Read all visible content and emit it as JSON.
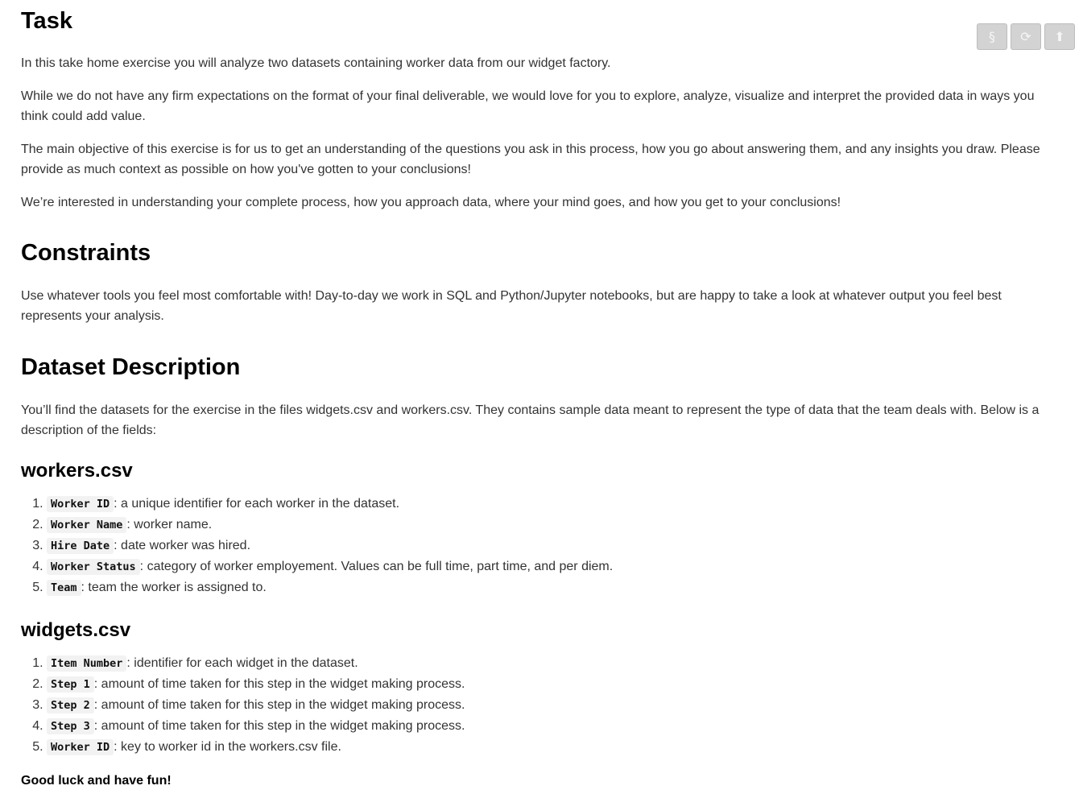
{
  "toolbar": {
    "buttons": [
      {
        "icon": "section-icon",
        "glyph": "§"
      },
      {
        "icon": "refresh-icon",
        "glyph": "⟳"
      },
      {
        "icon": "upload-icon",
        "glyph": "⬆"
      }
    ]
  },
  "task": {
    "heading": "Task",
    "p1": "In this take home exercise you will analyze two datasets containing worker data from our widget factory.",
    "p2": "While we do not have any firm expectations on the format of your final deliverable, we would love for you to explore, analyze, visualize and interpret the provided data in ways you think could add value.",
    "p3": "The main objective of this exercise is for us to get an understanding of the questions you ask in this process, how you go about answering them, and any insights you draw. Please provide as much context as possible on how you've gotten to your conclusions!",
    "p4": "We’re interested in understanding your complete process, how you approach data, where your mind goes, and how you get to your conclusions!"
  },
  "constraints": {
    "heading": "Constraints",
    "p1": "Use whatever tools you feel most comfortable with! Day-to-day we work in SQL and Python/Jupyter notebooks, but are happy to take a look at whatever output you feel best represents your analysis."
  },
  "dataset": {
    "heading": "Dataset Description",
    "p1": "You’ll find the datasets for the exercise in the files widgets.csv and workers.csv. They contains sample data meant to represent the type of data that the team deals with. Below is a description of the fields:"
  },
  "workers": {
    "heading": "workers.csv",
    "items": [
      {
        "field": "Worker ID",
        "desc": ": a unique identifier for each worker in the dataset."
      },
      {
        "field": "Worker Name",
        "desc": ": worker name."
      },
      {
        "field": "Hire Date",
        "desc": ": date worker was hired."
      },
      {
        "field": "Worker Status",
        "desc": ": category of worker employement. Values can be full time, part time, and per diem."
      },
      {
        "field": "Team",
        "desc": ": team the worker is assigned to."
      }
    ]
  },
  "widgets": {
    "heading": "widgets.csv",
    "items": [
      {
        "field": "Item Number",
        "desc": ": identifier for each widget in the dataset."
      },
      {
        "field": "Step 1",
        "desc": ": amount of time taken for this step in the widget making process."
      },
      {
        "field": "Step 2",
        "desc": ": amount of time taken for this step in the widget making process."
      },
      {
        "field": "Step 3",
        "desc": ": amount of time taken for this step in the widget making process."
      },
      {
        "field": "Worker ID",
        "desc": ": key to worker id in the workers.csv file."
      }
    ]
  },
  "closing": "Good luck and have fun!"
}
